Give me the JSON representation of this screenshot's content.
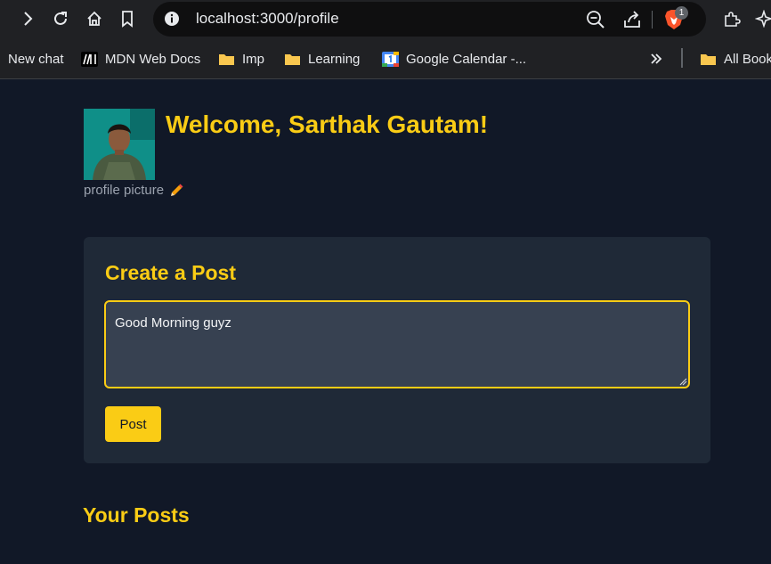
{
  "browser": {
    "url": "localhost:3000/profile",
    "extension_badge": "1",
    "icons": [
      "forward-icon",
      "reload-icon",
      "home-icon",
      "bookmark-icon",
      "info-icon",
      "zoom-out-icon",
      "share-icon",
      "brave-shield-icon",
      "extensions-icon",
      "leo-icon"
    ]
  },
  "bookmarks": {
    "items": [
      {
        "label": "New chat"
      },
      {
        "label": "MDN Web Docs"
      },
      {
        "label": "Imp"
      },
      {
        "label": "Learning"
      },
      {
        "label": "Google Calendar -..."
      },
      {
        "label": "All Bookmarks"
      }
    ],
    "overflow_icon": "chevrons-right-icon"
  },
  "profile": {
    "welcome": "Welcome, Sarthak Gautam!",
    "picture_label": "profile picture"
  },
  "create_post": {
    "title": "Create a Post",
    "textarea_value": "Good Morning guyz",
    "submit_label": "Post"
  },
  "posts_section": {
    "title": "Your Posts"
  },
  "colors": {
    "accent": "#facc15",
    "page_bg": "#111827",
    "card_bg": "#1f2937",
    "input_bg": "#374151",
    "browser_bg": "#202124"
  }
}
